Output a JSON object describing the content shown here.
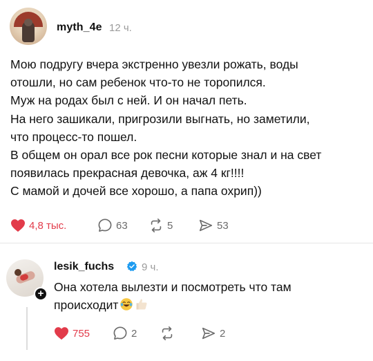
{
  "post": {
    "username": "myth_4e",
    "time": "12 ч.",
    "lines": [
      "Мою подругу вчера экстренно увезли рожать, воды",
      "отошли, но сам ребенок что-то не торопился.",
      "Муж на родах был с ней. И он начал петь.",
      "На него зашикали, пригрозили выгнать, но заметили,",
      "что процесс-то пошел.",
      "В общем он орал все рок песни которые знал и на свет",
      "появилась прекрасная девочка, аж 4 кг!!!!",
      "С мамой и дочей все хорошо, а папа охрип))"
    ],
    "actions": {
      "likes": "4,8 тыс.",
      "comments": "63",
      "reposts": "5",
      "shares": "53"
    }
  },
  "reply": {
    "username": "lesik_fuchs",
    "time": "9 ч.",
    "lines": [
      "Она хотела вылезти и посмотреть что там",
      "происходит"
    ],
    "emojis": [
      "laughing-with-tears-emoji",
      "thumbs-up-emoji"
    ],
    "actions": {
      "likes": "755",
      "comments": "2",
      "shares": "2"
    }
  },
  "colors": {
    "like": "#e23b4a",
    "verified": "#1d9bf0",
    "muted": "#9a9a9a",
    "text": "#111111"
  },
  "icons": [
    "heart-icon",
    "comment-icon",
    "repost-icon",
    "share-icon",
    "verified-icon",
    "plus-icon"
  ]
}
